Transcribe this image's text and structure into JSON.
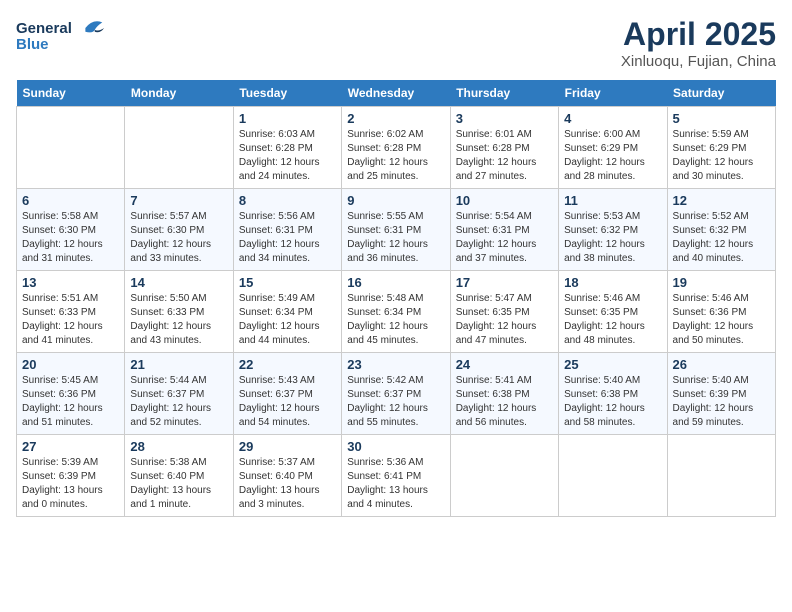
{
  "header": {
    "logo_general": "General",
    "logo_blue": "Blue",
    "month_title": "April 2025",
    "location": "Xinluoqu, Fujian, China"
  },
  "weekdays": [
    "Sunday",
    "Monday",
    "Tuesday",
    "Wednesday",
    "Thursday",
    "Friday",
    "Saturday"
  ],
  "weeks": [
    [
      {
        "day": "",
        "info": ""
      },
      {
        "day": "",
        "info": ""
      },
      {
        "day": "1",
        "info": "Sunrise: 6:03 AM\nSunset: 6:28 PM\nDaylight: 12 hours and 24 minutes."
      },
      {
        "day": "2",
        "info": "Sunrise: 6:02 AM\nSunset: 6:28 PM\nDaylight: 12 hours and 25 minutes."
      },
      {
        "day": "3",
        "info": "Sunrise: 6:01 AM\nSunset: 6:28 PM\nDaylight: 12 hours and 27 minutes."
      },
      {
        "day": "4",
        "info": "Sunrise: 6:00 AM\nSunset: 6:29 PM\nDaylight: 12 hours and 28 minutes."
      },
      {
        "day": "5",
        "info": "Sunrise: 5:59 AM\nSunset: 6:29 PM\nDaylight: 12 hours and 30 minutes."
      }
    ],
    [
      {
        "day": "6",
        "info": "Sunrise: 5:58 AM\nSunset: 6:30 PM\nDaylight: 12 hours and 31 minutes."
      },
      {
        "day": "7",
        "info": "Sunrise: 5:57 AM\nSunset: 6:30 PM\nDaylight: 12 hours and 33 minutes."
      },
      {
        "day": "8",
        "info": "Sunrise: 5:56 AM\nSunset: 6:31 PM\nDaylight: 12 hours and 34 minutes."
      },
      {
        "day": "9",
        "info": "Sunrise: 5:55 AM\nSunset: 6:31 PM\nDaylight: 12 hours and 36 minutes."
      },
      {
        "day": "10",
        "info": "Sunrise: 5:54 AM\nSunset: 6:31 PM\nDaylight: 12 hours and 37 minutes."
      },
      {
        "day": "11",
        "info": "Sunrise: 5:53 AM\nSunset: 6:32 PM\nDaylight: 12 hours and 38 minutes."
      },
      {
        "day": "12",
        "info": "Sunrise: 5:52 AM\nSunset: 6:32 PM\nDaylight: 12 hours and 40 minutes."
      }
    ],
    [
      {
        "day": "13",
        "info": "Sunrise: 5:51 AM\nSunset: 6:33 PM\nDaylight: 12 hours and 41 minutes."
      },
      {
        "day": "14",
        "info": "Sunrise: 5:50 AM\nSunset: 6:33 PM\nDaylight: 12 hours and 43 minutes."
      },
      {
        "day": "15",
        "info": "Sunrise: 5:49 AM\nSunset: 6:34 PM\nDaylight: 12 hours and 44 minutes."
      },
      {
        "day": "16",
        "info": "Sunrise: 5:48 AM\nSunset: 6:34 PM\nDaylight: 12 hours and 45 minutes."
      },
      {
        "day": "17",
        "info": "Sunrise: 5:47 AM\nSunset: 6:35 PM\nDaylight: 12 hours and 47 minutes."
      },
      {
        "day": "18",
        "info": "Sunrise: 5:46 AM\nSunset: 6:35 PM\nDaylight: 12 hours and 48 minutes."
      },
      {
        "day": "19",
        "info": "Sunrise: 5:46 AM\nSunset: 6:36 PM\nDaylight: 12 hours and 50 minutes."
      }
    ],
    [
      {
        "day": "20",
        "info": "Sunrise: 5:45 AM\nSunset: 6:36 PM\nDaylight: 12 hours and 51 minutes."
      },
      {
        "day": "21",
        "info": "Sunrise: 5:44 AM\nSunset: 6:37 PM\nDaylight: 12 hours and 52 minutes."
      },
      {
        "day": "22",
        "info": "Sunrise: 5:43 AM\nSunset: 6:37 PM\nDaylight: 12 hours and 54 minutes."
      },
      {
        "day": "23",
        "info": "Sunrise: 5:42 AM\nSunset: 6:37 PM\nDaylight: 12 hours and 55 minutes."
      },
      {
        "day": "24",
        "info": "Sunrise: 5:41 AM\nSunset: 6:38 PM\nDaylight: 12 hours and 56 minutes."
      },
      {
        "day": "25",
        "info": "Sunrise: 5:40 AM\nSunset: 6:38 PM\nDaylight: 12 hours and 58 minutes."
      },
      {
        "day": "26",
        "info": "Sunrise: 5:40 AM\nSunset: 6:39 PM\nDaylight: 12 hours and 59 minutes."
      }
    ],
    [
      {
        "day": "27",
        "info": "Sunrise: 5:39 AM\nSunset: 6:39 PM\nDaylight: 13 hours and 0 minutes."
      },
      {
        "day": "28",
        "info": "Sunrise: 5:38 AM\nSunset: 6:40 PM\nDaylight: 13 hours and 1 minute."
      },
      {
        "day": "29",
        "info": "Sunrise: 5:37 AM\nSunset: 6:40 PM\nDaylight: 13 hours and 3 minutes."
      },
      {
        "day": "30",
        "info": "Sunrise: 5:36 AM\nSunset: 6:41 PM\nDaylight: 13 hours and 4 minutes."
      },
      {
        "day": "",
        "info": ""
      },
      {
        "day": "",
        "info": ""
      },
      {
        "day": "",
        "info": ""
      }
    ]
  ]
}
